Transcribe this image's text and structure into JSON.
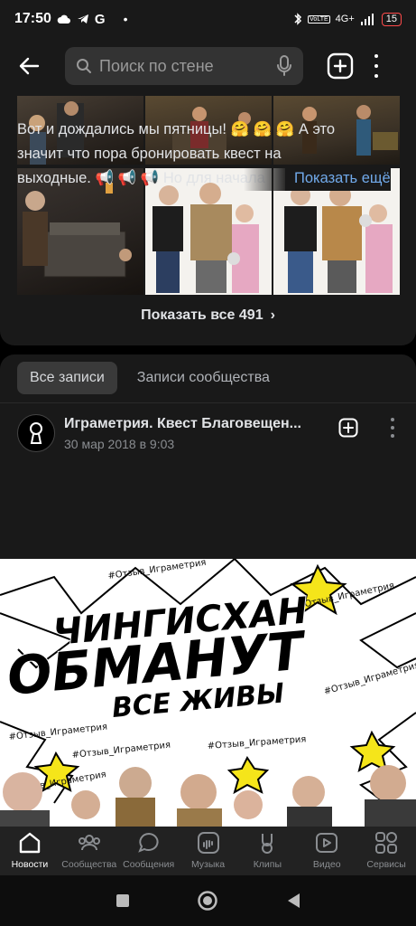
{
  "status_bar": {
    "time": "17:50",
    "network": "4G+",
    "battery": "15"
  },
  "header": {
    "search_placeholder": "Поиск по стене"
  },
  "photos": {
    "show_all_label": "Показать все 491"
  },
  "tabs": [
    {
      "label": "Все записи",
      "active": true
    },
    {
      "label": "Записи сообщества",
      "active": false
    }
  ],
  "post": {
    "author": "Играметрия. Квест Благовещен...",
    "date": "30 мар 2018 в 9:03",
    "text_line1": "Вот и дождались мы пятницы! 🤗 🤗 🤗  А это",
    "text_line2": "значит что пора бронировать квест на",
    "text_line3": "выходные. 📢 📢 📢  Но для начала",
    "show_more": "Показать ещё",
    "image": {
      "line1": "ЧИНГИСХАН",
      "line2": "ОБМАНУТ",
      "line3": "ВСЕ ЖИВЫ",
      "hashtag": "#Отзыв_Играметрия"
    }
  },
  "bottom_nav": [
    {
      "label": "Новости",
      "icon": "home-icon",
      "active": true
    },
    {
      "label": "Сообщества",
      "icon": "communities-icon",
      "active": false
    },
    {
      "label": "Сообщения",
      "icon": "messages-icon",
      "active": false
    },
    {
      "label": "Музыка",
      "icon": "music-icon",
      "active": false
    },
    {
      "label": "Клипы",
      "icon": "clips-icon",
      "active": false
    },
    {
      "label": "Видео",
      "icon": "video-icon",
      "active": false
    },
    {
      "label": "Сервисы",
      "icon": "services-icon",
      "active": false
    }
  ],
  "colors": {
    "background": "#191919",
    "accent": "#71aaeb",
    "search_bg": "#333333",
    "battery": "#ff4b4b"
  }
}
